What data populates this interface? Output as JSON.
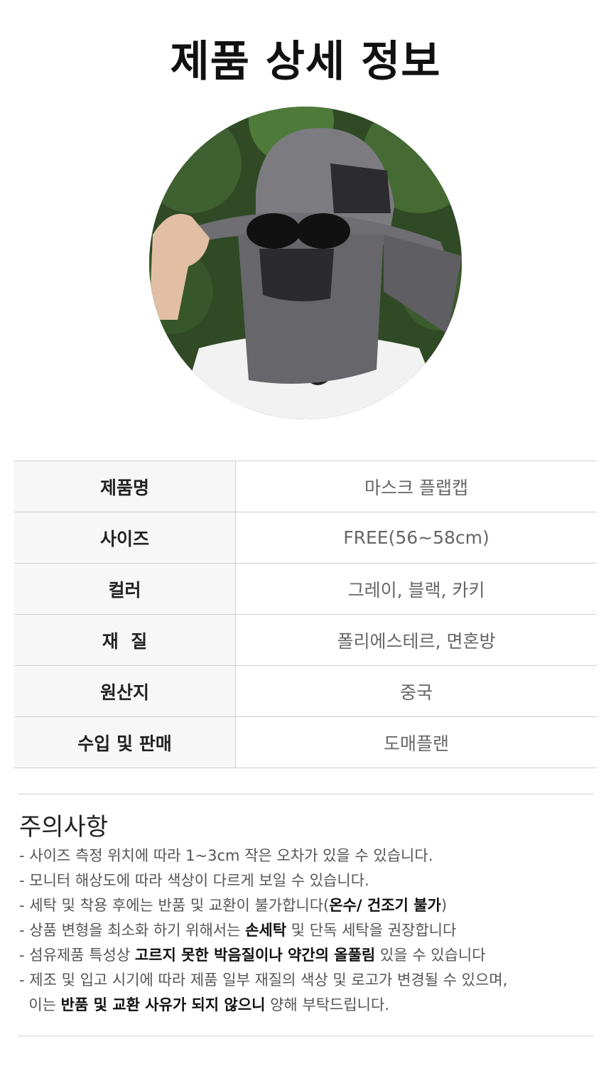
{
  "header": {
    "title": "제품 상세 정보"
  },
  "photo": {
    "alt": "모자 착용 사진"
  },
  "spec_table": {
    "rows": [
      {
        "label": "제품명",
        "value": "마스크 플랩캡"
      },
      {
        "label": "사이즈",
        "value": "FREE(56~58cm)"
      },
      {
        "label": "컬러",
        "value": "그레이, 블랙, 카키"
      },
      {
        "label": "재  질",
        "value": "폴리에스테르, 면혼방"
      },
      {
        "label": "원산지",
        "value": "중국"
      },
      {
        "label": "수입 및 판매",
        "value": "도매플랜"
      }
    ]
  },
  "notice": {
    "title": "주의사항",
    "items": [
      {
        "t1": "- 사이즈 측정 위치에 따라 1~3cm 작은 오차가 있을 수 있습니다.",
        "b1": "",
        "t2": "",
        "b2": "",
        "t3": ""
      },
      {
        "t1": "- 모니터 해상도에 따라 색상이 다르게 보일 수 있습니다.",
        "b1": "",
        "t2": "",
        "b2": "",
        "t3": ""
      },
      {
        "t1": "- 세탁 및 착용 후에는 반품 및 교환이 불가합니다(",
        "b1": "온수/ 건조기 불가",
        "t2": ")",
        "b2": "",
        "t3": ""
      },
      {
        "t1": "- 상품 변형을 최소화 하기 위해서는 ",
        "b1": "손세탁",
        "t2": " 및 단독 세탁을 권장합니다",
        "b2": "",
        "t3": ""
      },
      {
        "t1": "- 섬유제품 특성상 ",
        "b1": "고르지 못한 박음질이나 약간의 올풀림",
        "t2": " 있을 수 있습니다",
        "b2": "",
        "t3": ""
      },
      {
        "t1": "- 제조 및 입고 시기에 따라 제품 일부 재질의 색상 및 로고가 변경될 수 있으며,",
        "b1": "",
        "t2": "",
        "b2": "",
        "t3": ""
      },
      {
        "t1": "  이는 ",
        "b1": "반품 및 교환 사유가 되지 않으니",
        "t2": " 양해 부탁드립니다.",
        "b2": "",
        "t3": ""
      }
    ]
  }
}
